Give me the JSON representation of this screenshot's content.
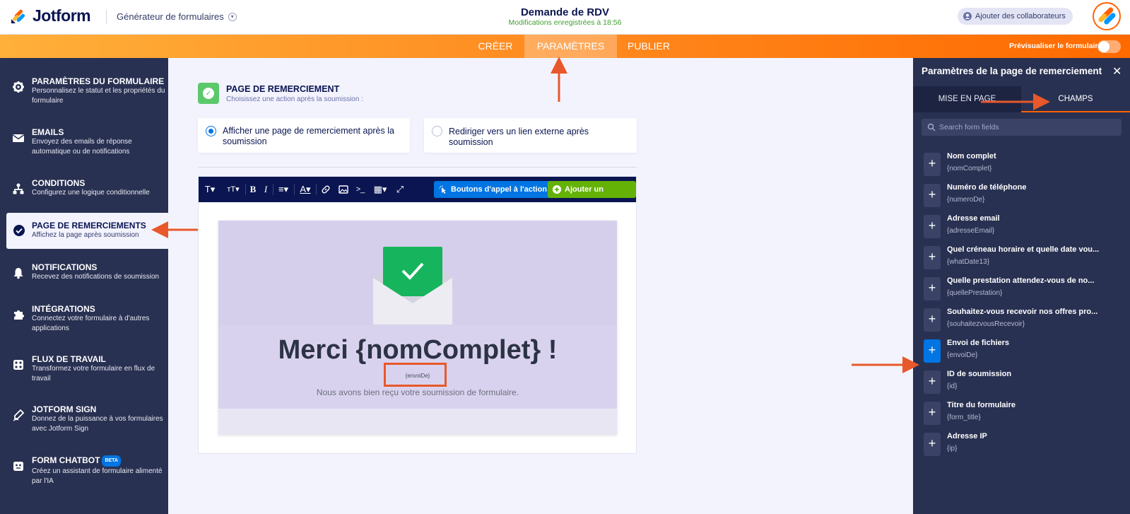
{
  "header": {
    "logo_text": "Jotform",
    "builder_label": "Générateur de formulaires",
    "form_title": "Demande de RDV",
    "save_status": "Modifications enregistrées à 18:56",
    "collab_button": "Ajouter des collaborateurs"
  },
  "nav": {
    "tabs": [
      {
        "label": "CRÉER"
      },
      {
        "label": "PARAMÈTRES"
      },
      {
        "label": "PUBLIER"
      }
    ],
    "active_tab": "PARAMÈTRES",
    "preview_label": "Prévisualiser le formulaire"
  },
  "sidebar": {
    "items": [
      {
        "title": "PARAMÈTRES DU FORMULAIRE",
        "desc": "Personnalisez le statut et les propriétés du formulaire",
        "icon": "gear-icon"
      },
      {
        "title": "EMAILS",
        "desc": "Envoyez des emails de réponse automatique ou de notifications",
        "icon": "envelope-icon"
      },
      {
        "title": "CONDITIONS",
        "desc": "Configurez une logique conditionnelle",
        "icon": "hierarchy-icon"
      },
      {
        "title": "PAGE DE REMERCIEMENTS",
        "desc": "Affichez la page après soumission",
        "icon": "check-circle-icon"
      },
      {
        "title": "NOTIFICATIONS",
        "desc": "Recevez des notifications de soumission",
        "icon": "bell-icon"
      },
      {
        "title": "INTÉGRATIONS",
        "desc": "Connectez votre formulaire à d'autres applications",
        "icon": "puzzle-icon"
      },
      {
        "title": "FLUX DE TRAVAIL",
        "desc": "Transformez votre formulaire en flux de travail",
        "icon": "workflow-icon"
      },
      {
        "title": "JOTFORM SIGN",
        "desc": "Donnez de la puissance à vos formulaires avec Jotform Sign",
        "icon": "pen-icon"
      },
      {
        "title": "FORM CHATBOT",
        "desc": "Créez un assistant de formulaire alimenté par l'IA",
        "icon": "chatbot-icon",
        "badge": "BETA"
      }
    ],
    "active_index": 3
  },
  "main": {
    "section_title": "PAGE DE REMERCIEMENT",
    "section_subtitle": "Choisissez une action après la soumission :",
    "options": [
      {
        "label": "Afficher une page de remerciement après la soumission",
        "selected": true
      },
      {
        "label": "Rediriger vers un lien externe après soumission",
        "selected": false
      }
    ],
    "toolbar": {
      "cta_button": "Boutons d'appel à l'action",
      "add_field_button": "Ajouter un champ"
    },
    "preview": {
      "headline": "Merci {nomComplet} !",
      "variable": "{envoiDe}",
      "message": "Nous avons bien reçu votre soumission de formulaire."
    }
  },
  "right_panel": {
    "title": "Paramètres de la page de remerciement",
    "tabs": [
      {
        "label": "MISE EN PAGE"
      },
      {
        "label": "CHAMPS"
      }
    ],
    "active_tab": "CHAMPS",
    "search_placeholder": "Search form fields",
    "fields": [
      {
        "name": "Nom complet",
        "var": "{nomComplet}"
      },
      {
        "name": "Numéro de téléphone",
        "var": "{numeroDe}"
      },
      {
        "name": "Adresse email",
        "var": "{adresseEmail}"
      },
      {
        "name": "Quel créneau horaire et quelle date vou...",
        "var": "{whatDate13}"
      },
      {
        "name": "Quelle prestation attendez-vous de no...",
        "var": "{quellePrestation}"
      },
      {
        "name": "Souhaitez-vous recevoir nos offres pro...",
        "var": "{souhaitezvousRecevoir}"
      },
      {
        "name": "Envoi de fichiers",
        "var": "{envoiDe}",
        "selected": true
      },
      {
        "name": "ID de soumission",
        "var": "{id}"
      },
      {
        "name": "Titre du formulaire",
        "var": "{form_title}"
      },
      {
        "name": "Adresse IP",
        "var": "{ip}"
      }
    ]
  },
  "colors": {
    "orange_accent": "#ff6100",
    "navy": "#0a1551",
    "panel": "#293152",
    "blue": "#0075e3",
    "green": "#64b206",
    "annotation": "#e8582a"
  }
}
